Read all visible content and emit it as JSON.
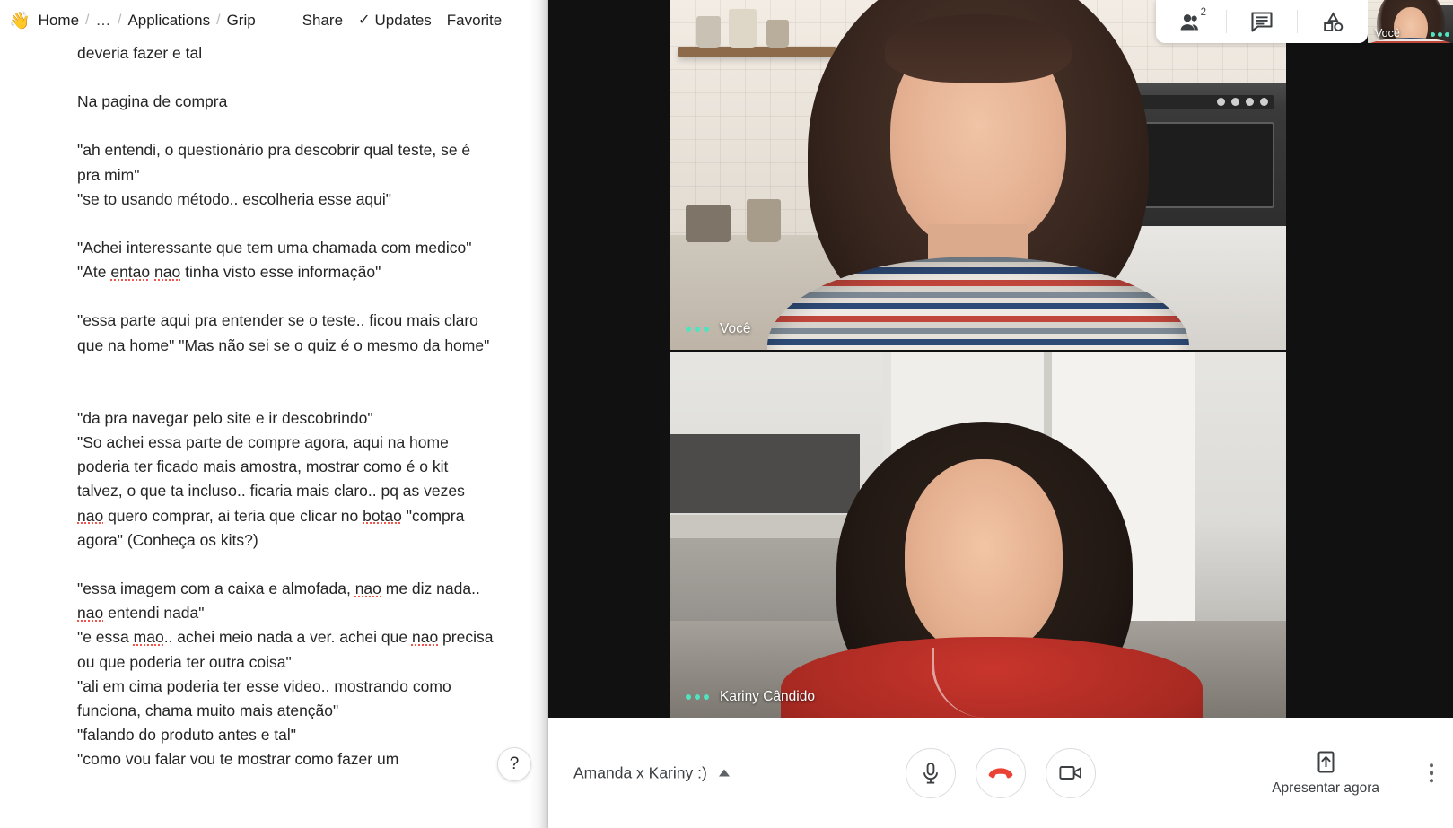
{
  "document_app": {
    "breadcrumb": {
      "emoji": "👋",
      "items": [
        "Home",
        "…",
        "Applications",
        "Grip"
      ],
      "separator": "/"
    },
    "actions": {
      "share": "Share",
      "updates": "Updates",
      "favorite": "Favorite",
      "more": "•••",
      "check_icon": "✓"
    },
    "help_button": "?",
    "content": {
      "paragraphs": [
        {
          "lines": [
            "deveria fazer e tal"
          ]
        },
        {
          "lines": [
            "Na pagina de compra"
          ]
        },
        {
          "lines": [
            "\"ah entendi, o questionário pra descobrir qual teste, se é pra mim\"",
            "\"se to usando método.. escolheria esse aqui\""
          ]
        },
        {
          "lines": [
            "\"Achei interessante que tem uma chamada com medico\" \"Ate entao nao tinha visto esse informação\""
          ],
          "misspelled": [
            "entao",
            "nao"
          ]
        },
        {
          "lines": [
            "\"essa parte aqui pra entender se o teste.. ficou mais claro que na home\" \"Mas não sei se o quiz é o mesmo da home\""
          ]
        },
        {
          "lines": [
            "\"da pra navegar pelo site e ir descobrindo\"",
            "\"So achei essa parte de compre agora, aqui na home poderia ter ficado mais amostra, mostrar como é o kit talvez, o que ta incluso.. ficaria mais claro.. pq as vezes nao quero comprar, ai teria que clicar no botao \"compra agora\" (Conheça os kits?)"
          ],
          "misspelled": [
            "nao",
            "botao"
          ]
        },
        {
          "lines": [
            "\"essa imagem com a caixa e almofada, nao me diz nada.. nao entendi nada\"",
            "\"e essa mao.. achei meio nada a ver. achei que nao precisa ou que poderia ter outra coisa\"",
            "\"ali em cima poderia ter esse video.. mostrando como funciona, chama muito mais atenção\"",
            "\"falando do produto antes e tal\"",
            "\"como vou falar vou te mostrar como fazer um"
          ],
          "misspelled": [
            "nao",
            "mao"
          ]
        }
      ]
    }
  },
  "video_call": {
    "toolbar": {
      "participants_icon": "people-icon",
      "participants_count": "2",
      "chat_icon": "chat-icon",
      "activities_icon": "activities-shapes-icon"
    },
    "self_view": {
      "label": "Você",
      "audio_indicator": "active"
    },
    "tiles": [
      {
        "name": "Você",
        "audio_indicator": "active"
      },
      {
        "name": "Kariny Cândido",
        "audio_indicator": "active"
      }
    ],
    "bottom_bar": {
      "meeting_name": "Amanda x Kariny :)",
      "expand_icon": "caret-up-icon",
      "mic_icon": "microphone-icon",
      "hangup_icon": "hangup-phone-icon",
      "camera_icon": "video-camera-icon",
      "present_icon": "present-screen-icon",
      "present_label": "Apresentar agora",
      "more_icon": "more-vertical-icon"
    },
    "colors": {
      "hangup_red": "#ea4335",
      "audio_green": "#4fe3c1",
      "stage_background": "#111111",
      "bar_background": "#ffffff"
    }
  }
}
